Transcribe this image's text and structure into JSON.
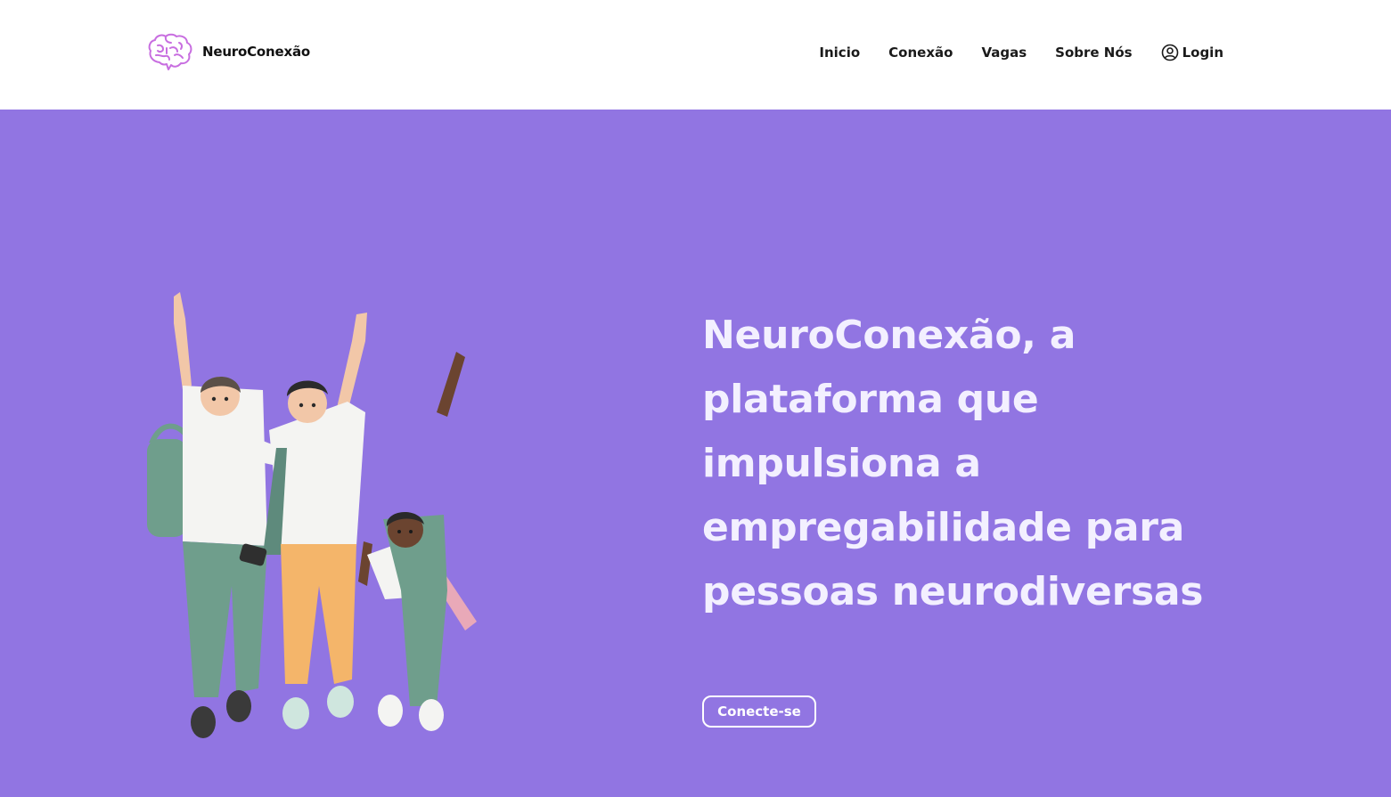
{
  "header": {
    "brand_name": "NeuroConexão",
    "logo_icon": "brain-icon",
    "nav": [
      {
        "label": "Inicio"
      },
      {
        "label": "Conexão"
      },
      {
        "label": "Vagas"
      },
      {
        "label": "Sobre Nós"
      }
    ],
    "login": {
      "label": "Login",
      "icon": "user-circle-icon"
    }
  },
  "hero": {
    "headline": "NeuroConexão, a plataforma que impulsiona a empregabilidade para pessoas neurodiversas",
    "cta_label": "Conecte-se",
    "illustration": "three-students-celebrating-illustration"
  },
  "colors": {
    "hero_background": "#9175e2",
    "header_background": "#ffffff",
    "brand_accent": "#c86ee0",
    "headline_text": "#f3f0ff"
  }
}
